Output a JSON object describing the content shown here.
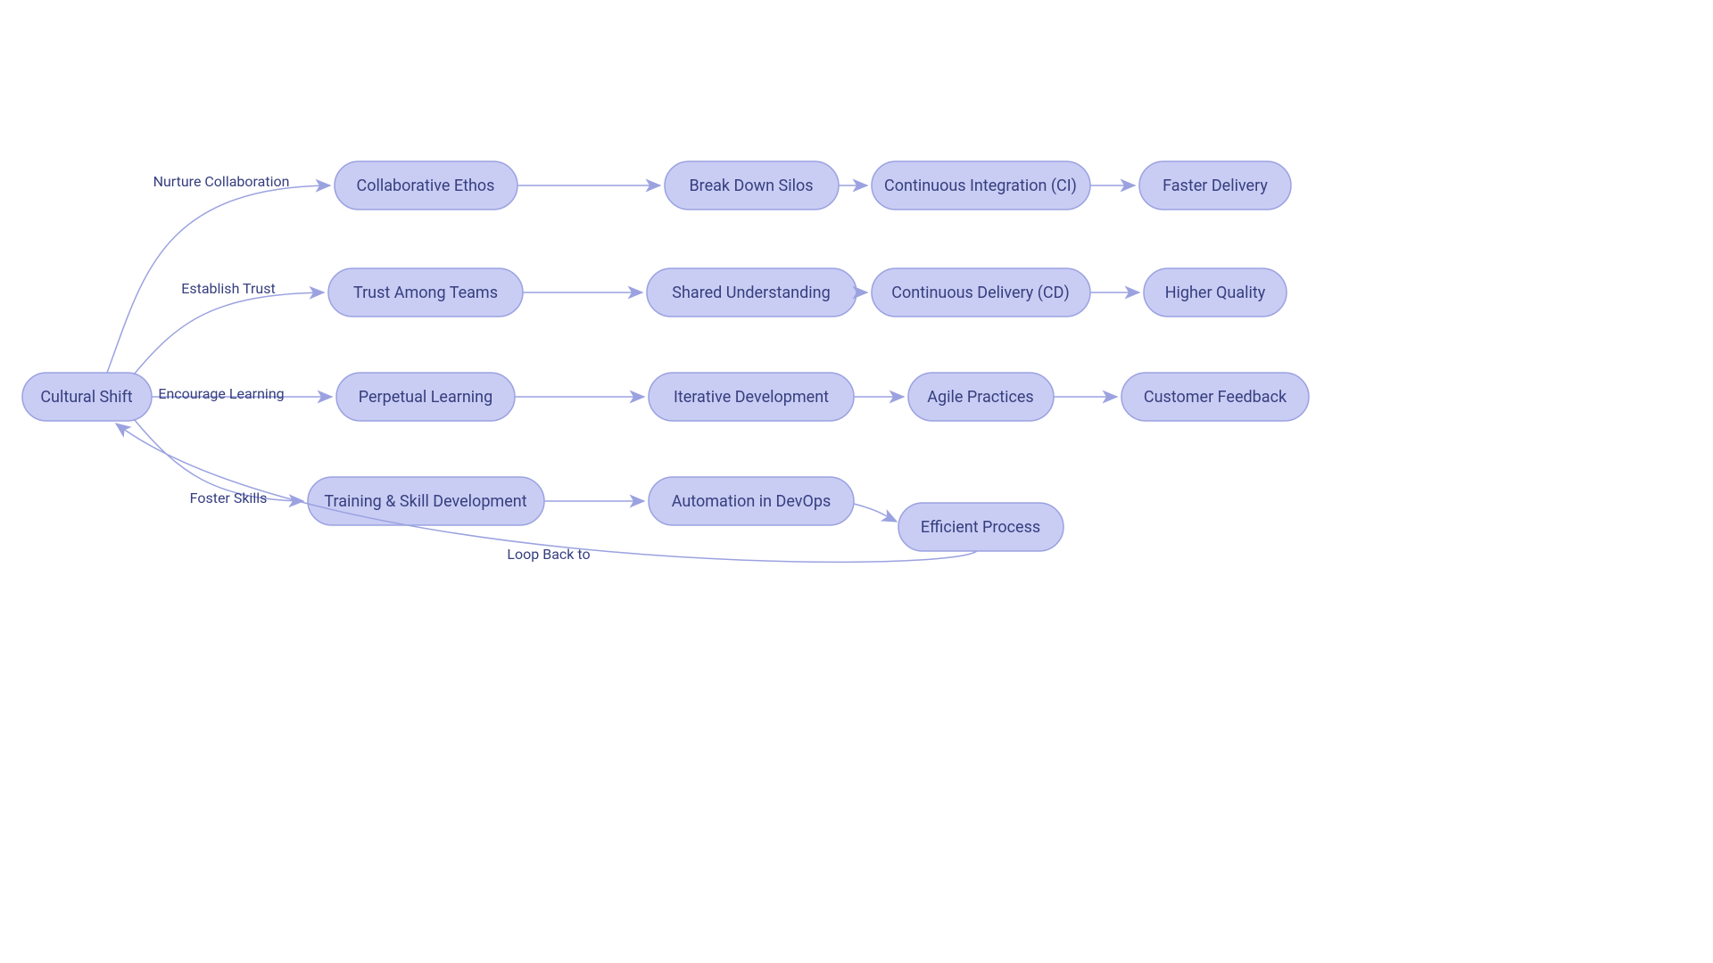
{
  "nodes": {
    "cultural_shift": "Cultural Shift",
    "collaborative_ethos": "Collaborative Ethos",
    "trust_among_teams": "Trust Among Teams",
    "perpetual_learning": "Perpetual Learning",
    "training_skill": "Training & Skill Development",
    "break_down_silos": "Break Down Silos",
    "shared_understanding": "Shared Understanding",
    "iterative_development": "Iterative Development",
    "automation_devops": "Automation in DevOps",
    "continuous_integration": "Continuous Integration (CI)",
    "continuous_delivery": "Continuous Delivery (CD)",
    "agile_practices": "Agile Practices",
    "efficient_process": "Efficient Process",
    "faster_delivery": "Faster Delivery",
    "higher_quality": "Higher Quality",
    "customer_feedback": "Customer Feedback"
  },
  "edges": {
    "nurture_collaboration": "Nurture Collaboration",
    "establish_trust": "Establish Trust",
    "encourage_learning": "Encourage Learning",
    "foster_skills": "Foster Skills",
    "loop_back": "Loop Back to"
  },
  "colors": {
    "node_fill": "#c9cdf4",
    "node_stroke": "#9ba2e0",
    "text": "#363e7e",
    "edge": "#9ba2e0"
  }
}
